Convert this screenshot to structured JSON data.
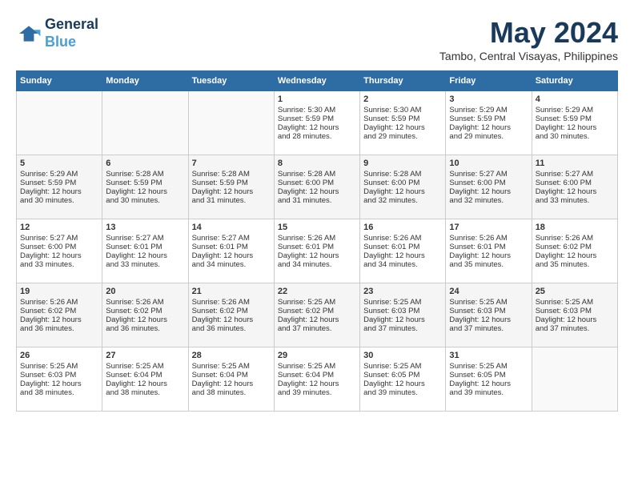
{
  "logo": {
    "line1": "General",
    "line2": "Blue"
  },
  "title": "May 2024",
  "subtitle": "Tambo, Central Visayas, Philippines",
  "days_header": [
    "Sunday",
    "Monday",
    "Tuesday",
    "Wednesday",
    "Thursday",
    "Friday",
    "Saturday"
  ],
  "weeks": [
    [
      {
        "day": "",
        "content": ""
      },
      {
        "day": "",
        "content": ""
      },
      {
        "day": "",
        "content": ""
      },
      {
        "day": "1",
        "content": "Sunrise: 5:30 AM\nSunset: 5:59 PM\nDaylight: 12 hours\nand 28 minutes."
      },
      {
        "day": "2",
        "content": "Sunrise: 5:30 AM\nSunset: 5:59 PM\nDaylight: 12 hours\nand 29 minutes."
      },
      {
        "day": "3",
        "content": "Sunrise: 5:29 AM\nSunset: 5:59 PM\nDaylight: 12 hours\nand 29 minutes."
      },
      {
        "day": "4",
        "content": "Sunrise: 5:29 AM\nSunset: 5:59 PM\nDaylight: 12 hours\nand 30 minutes."
      }
    ],
    [
      {
        "day": "5",
        "content": "Sunrise: 5:29 AM\nSunset: 5:59 PM\nDaylight: 12 hours\nand 30 minutes."
      },
      {
        "day": "6",
        "content": "Sunrise: 5:28 AM\nSunset: 5:59 PM\nDaylight: 12 hours\nand 30 minutes."
      },
      {
        "day": "7",
        "content": "Sunrise: 5:28 AM\nSunset: 5:59 PM\nDaylight: 12 hours\nand 31 minutes."
      },
      {
        "day": "8",
        "content": "Sunrise: 5:28 AM\nSunset: 6:00 PM\nDaylight: 12 hours\nand 31 minutes."
      },
      {
        "day": "9",
        "content": "Sunrise: 5:28 AM\nSunset: 6:00 PM\nDaylight: 12 hours\nand 32 minutes."
      },
      {
        "day": "10",
        "content": "Sunrise: 5:27 AM\nSunset: 6:00 PM\nDaylight: 12 hours\nand 32 minutes."
      },
      {
        "day": "11",
        "content": "Sunrise: 5:27 AM\nSunset: 6:00 PM\nDaylight: 12 hours\nand 33 minutes."
      }
    ],
    [
      {
        "day": "12",
        "content": "Sunrise: 5:27 AM\nSunset: 6:00 PM\nDaylight: 12 hours\nand 33 minutes."
      },
      {
        "day": "13",
        "content": "Sunrise: 5:27 AM\nSunset: 6:01 PM\nDaylight: 12 hours\nand 33 minutes."
      },
      {
        "day": "14",
        "content": "Sunrise: 5:27 AM\nSunset: 6:01 PM\nDaylight: 12 hours\nand 34 minutes."
      },
      {
        "day": "15",
        "content": "Sunrise: 5:26 AM\nSunset: 6:01 PM\nDaylight: 12 hours\nand 34 minutes."
      },
      {
        "day": "16",
        "content": "Sunrise: 5:26 AM\nSunset: 6:01 PM\nDaylight: 12 hours\nand 34 minutes."
      },
      {
        "day": "17",
        "content": "Sunrise: 5:26 AM\nSunset: 6:01 PM\nDaylight: 12 hours\nand 35 minutes."
      },
      {
        "day": "18",
        "content": "Sunrise: 5:26 AM\nSunset: 6:02 PM\nDaylight: 12 hours\nand 35 minutes."
      }
    ],
    [
      {
        "day": "19",
        "content": "Sunrise: 5:26 AM\nSunset: 6:02 PM\nDaylight: 12 hours\nand 36 minutes."
      },
      {
        "day": "20",
        "content": "Sunrise: 5:26 AM\nSunset: 6:02 PM\nDaylight: 12 hours\nand 36 minutes."
      },
      {
        "day": "21",
        "content": "Sunrise: 5:26 AM\nSunset: 6:02 PM\nDaylight: 12 hours\nand 36 minutes."
      },
      {
        "day": "22",
        "content": "Sunrise: 5:25 AM\nSunset: 6:02 PM\nDaylight: 12 hours\nand 37 minutes."
      },
      {
        "day": "23",
        "content": "Sunrise: 5:25 AM\nSunset: 6:03 PM\nDaylight: 12 hours\nand 37 minutes."
      },
      {
        "day": "24",
        "content": "Sunrise: 5:25 AM\nSunset: 6:03 PM\nDaylight: 12 hours\nand 37 minutes."
      },
      {
        "day": "25",
        "content": "Sunrise: 5:25 AM\nSunset: 6:03 PM\nDaylight: 12 hours\nand 37 minutes."
      }
    ],
    [
      {
        "day": "26",
        "content": "Sunrise: 5:25 AM\nSunset: 6:03 PM\nDaylight: 12 hours\nand 38 minutes."
      },
      {
        "day": "27",
        "content": "Sunrise: 5:25 AM\nSunset: 6:04 PM\nDaylight: 12 hours\nand 38 minutes."
      },
      {
        "day": "28",
        "content": "Sunrise: 5:25 AM\nSunset: 6:04 PM\nDaylight: 12 hours\nand 38 minutes."
      },
      {
        "day": "29",
        "content": "Sunrise: 5:25 AM\nSunset: 6:04 PM\nDaylight: 12 hours\nand 39 minutes."
      },
      {
        "day": "30",
        "content": "Sunrise: 5:25 AM\nSunset: 6:05 PM\nDaylight: 12 hours\nand 39 minutes."
      },
      {
        "day": "31",
        "content": "Sunrise: 5:25 AM\nSunset: 6:05 PM\nDaylight: 12 hours\nand 39 minutes."
      },
      {
        "day": "",
        "content": ""
      }
    ]
  ]
}
